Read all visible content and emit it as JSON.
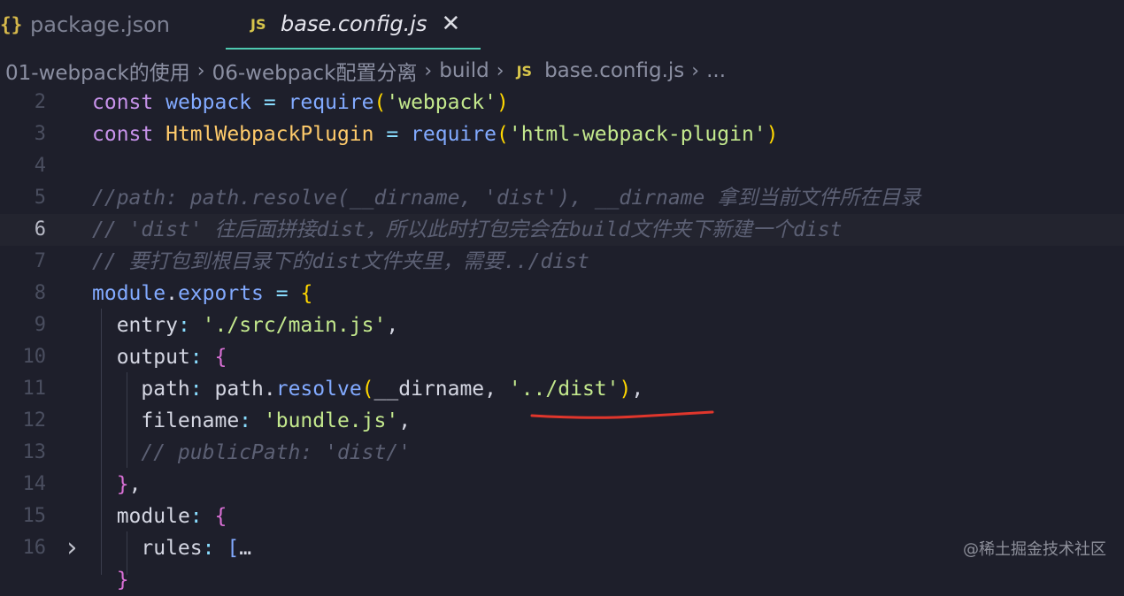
{
  "tabs": [
    {
      "icon": "{}",
      "label": "package.json"
    },
    {
      "icon": "JS",
      "label": "base.config.js",
      "close": "✕"
    }
  ],
  "breadcrumb": {
    "items": [
      "01-webpack的使用",
      "06-webpack配置分离",
      "build"
    ],
    "file_icon": "JS",
    "file": "base.config.js",
    "more": "...",
    "separator": "›"
  },
  "lines": [
    {
      "n": "2",
      "parts": [
        [
          "kw",
          "const "
        ],
        [
          "var",
          "webpack"
        ],
        [
          "op",
          " = "
        ],
        [
          "fn",
          "require"
        ],
        [
          "pn",
          "("
        ],
        [
          "str",
          "'webpack'"
        ],
        [
          "pn",
          ")"
        ]
      ]
    },
    {
      "n": "3",
      "parts": [
        [
          "kw",
          "const "
        ],
        [
          "cls",
          "HtmlWebpackPlugin"
        ],
        [
          "op",
          " = "
        ],
        [
          "fn",
          "require"
        ],
        [
          "pn",
          "("
        ],
        [
          "str",
          "'html-webpack-plugin'"
        ],
        [
          "pn",
          ")"
        ]
      ]
    },
    {
      "n": "4",
      "parts": []
    },
    {
      "n": "5",
      "parts": [
        [
          "cm",
          "//path: path.resolve(__dirname, 'dist'), __dirname 拿到当前文件所在目录"
        ]
      ]
    },
    {
      "n": "6",
      "parts": [
        [
          "cm",
          "// 'dist' 往后面拼接dist，所以此时打包完会在build文件夹下新建一个dist"
        ]
      ]
    },
    {
      "n": "7",
      "parts": [
        [
          "cm",
          "// 要打包到根目录下的dist文件夹里，需要../dist"
        ]
      ]
    },
    {
      "n": "8",
      "parts": [
        [
          "var",
          "module"
        ],
        [
          "plain",
          "."
        ],
        [
          "var",
          "exports"
        ],
        [
          "op",
          " = "
        ],
        [
          "pn",
          "{"
        ]
      ]
    },
    {
      "n": "9",
      "parts": [
        [
          "plain",
          "  "
        ],
        [
          "prop",
          "entry"
        ],
        [
          "op",
          ": "
        ],
        [
          "str",
          "'./src/main.js'"
        ],
        [
          "plain",
          ","
        ]
      ]
    },
    {
      "n": "10",
      "parts": [
        [
          "plain",
          "  "
        ],
        [
          "prop",
          "output"
        ],
        [
          "op",
          ": "
        ],
        [
          "pn2",
          "{"
        ]
      ]
    },
    {
      "n": "11",
      "parts": [
        [
          "plain",
          "    "
        ],
        [
          "prop",
          "path"
        ],
        [
          "op",
          ": "
        ],
        [
          "plain",
          "path."
        ],
        [
          "fn",
          "resolve"
        ],
        [
          "pn",
          "("
        ],
        [
          "plain",
          "__dirname, "
        ],
        [
          "str",
          "'../dist'"
        ],
        [
          "pn",
          ")"
        ],
        [
          "plain",
          ","
        ]
      ]
    },
    {
      "n": "12",
      "parts": [
        [
          "plain",
          "    "
        ],
        [
          "prop",
          "filename"
        ],
        [
          "op",
          ": "
        ],
        [
          "str",
          "'bundle.js'"
        ],
        [
          "plain",
          ","
        ]
      ]
    },
    {
      "n": "13",
      "parts": [
        [
          "plain",
          "    "
        ],
        [
          "cm",
          "// publicPath: 'dist/'"
        ]
      ]
    },
    {
      "n": "14",
      "parts": [
        [
          "plain",
          "  "
        ],
        [
          "pn2",
          "}"
        ],
        [
          "plain",
          ","
        ]
      ]
    },
    {
      "n": "15",
      "parts": [
        [
          "plain",
          "  "
        ],
        [
          "prop",
          "module"
        ],
        [
          "op",
          ": "
        ],
        [
          "pn2",
          "{"
        ]
      ]
    },
    {
      "n": "16",
      "parts": [
        [
          "plain",
          "    "
        ],
        [
          "prop",
          "rules"
        ],
        [
          "op",
          ": "
        ],
        [
          "var",
          "["
        ],
        [
          "plain",
          "…"
        ]
      ]
    },
    {
      "n": "",
      "parts": [
        [
          "plain",
          "  "
        ],
        [
          "pn2",
          "}"
        ]
      ]
    }
  ],
  "active_line": "6",
  "annotation_color": "#e0362c",
  "watermark": "@稀土掘金技术社区"
}
